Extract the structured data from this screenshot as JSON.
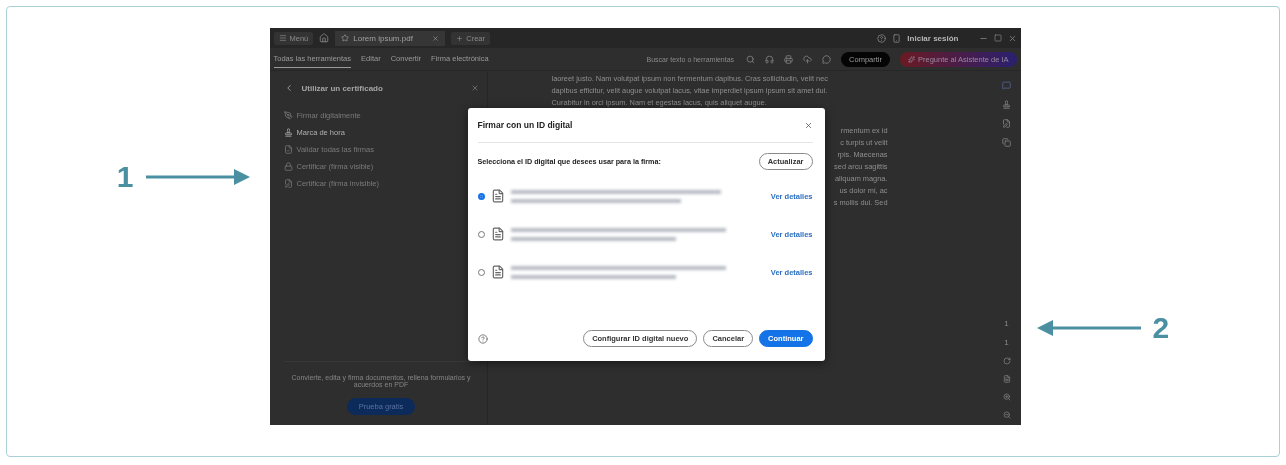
{
  "annotations": [
    {
      "label": "1"
    },
    {
      "label": "2"
    }
  ],
  "app": {
    "title_bar": {
      "menu": "Menú",
      "tabs": [
        {
          "label": "Lorem ipsum.pdf",
          "selected": true
        }
      ],
      "new_button": "Crear",
      "sign_in": "Iniciar sesión"
    },
    "toolbar": {
      "tabs": [
        {
          "label": "Todas las herramientas",
          "selected": true
        },
        {
          "label": "Editar",
          "selected": false
        },
        {
          "label": "Convertir",
          "selected": false
        },
        {
          "label": "Firma electrónica",
          "selected": false
        }
      ],
      "search": {
        "placeholder": "Buscar texto o herramientas"
      },
      "share": "Compartir",
      "assistant": "Pregunte al Asistente de IA"
    },
    "panel": {
      "title": "Utilizar un certificado",
      "items": [
        {
          "label": "Firmar digitalmente",
          "disabled": true
        },
        {
          "label": "Marca de hora",
          "disabled": false
        },
        {
          "label": "Validar todas las firmas",
          "disabled": true
        },
        {
          "label": "Certificar (firma visible)",
          "disabled": true
        },
        {
          "label": "Certificar (firma invisible)",
          "disabled": true
        }
      ],
      "promo": "Convierte, edita y firma documentos, rellena formularios y acuerdos en PDF",
      "promo_button": "Prueba gratis"
    },
    "document": {
      "lines": [
        "laoreet justo. Nam volutpat ipsum non fermentum dapibus. Cras sollicitudin, velit nec",
        "dapibus efficitur, velit augue volutpat lacus, vitae imperdiet ipsum ipsum sit amet dui.",
        "Curabitur in orci ipsum. Nam et egestas lacus, quis aliquet augue."
      ],
      "fragments": [
        "rmentum ex id",
        "c turpis ut velit",
        "rpis. Maecenas",
        "sed arcu sagittis",
        "aliquam magna.",
        "us dolor mi, ac",
        "s mollis dui. Sed"
      ]
    },
    "page_indicator": [
      "1",
      "1"
    ],
    "dialog": {
      "title": "Firmar con un ID digital",
      "prompt": "Selecciona el ID digital que desees usar para la firma:",
      "refresh": "Actualizar",
      "ids": [
        {
          "selected": true,
          "link": "Ver detalles"
        },
        {
          "selected": false,
          "link": "Ver detalles"
        },
        {
          "selected": false,
          "link": "Ver detalles"
        }
      ],
      "buttons": [
        {
          "label": "Configurar ID digital nuevo",
          "kind": "secondary"
        },
        {
          "label": "Cancelar",
          "kind": "secondary"
        },
        {
          "label": "Continuar",
          "kind": "primary"
        }
      ]
    }
  }
}
